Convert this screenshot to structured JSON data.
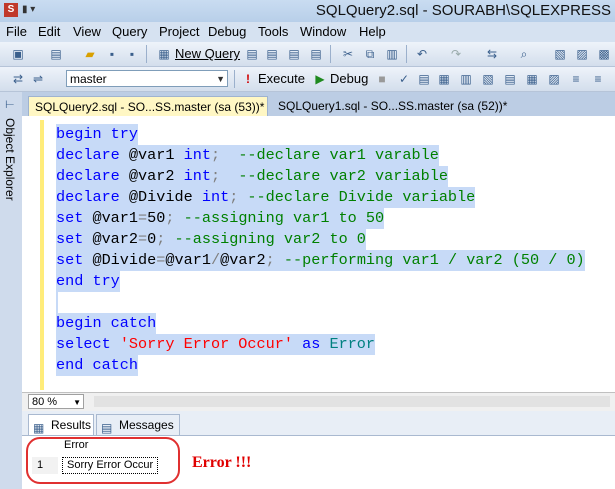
{
  "window": {
    "title": "SQLQuery2.sql - SOURABH\\SQLEXPRESS"
  },
  "menu": [
    "File",
    "Edit",
    "View",
    "Query",
    "Project",
    "Debug",
    "Tools",
    "Window",
    "Help"
  ],
  "toolbar1": {
    "new_query_label": "New Query"
  },
  "toolbar2": {
    "database_value": "master",
    "execute_label": "Execute",
    "debug_label": "Debug"
  },
  "sidebar": {
    "label": "Object Explorer"
  },
  "tabs": [
    {
      "label": "SQLQuery2.sql - SO...SS.master (sa (53))*",
      "active": true
    },
    {
      "label": "SQLQuery1.sql - SO...SS.master (sa (52))*",
      "active": false
    }
  ],
  "editor": {
    "lines": [
      "begin try",
      "declare @var1 int;  --declare var1 varable",
      "declare @var2 int;  --declare var2 variable",
      "declare @Divide int; --declare Divide variable",
      "set @var1=50; --assigning var1 to 50",
      "set @var2=0; --assigning var2 to 0",
      "set @Divide=@var1/@var2; --performing var1 / var2 (50 / 0)",
      "end try",
      "",
      "begin catch",
      "select 'Sorry Error Occur' as Error",
      "end catch"
    ]
  },
  "zoom": {
    "value": "80 %"
  },
  "results_tabs": [
    "Results",
    "Messages"
  ],
  "results_grid": {
    "columns": [
      "Error"
    ],
    "rows": [
      {
        "num": "1",
        "cells": [
          "Sorry Error Occur"
        ]
      }
    ]
  },
  "annotation": {
    "text": "Error !!!",
    "color": "#e00000"
  }
}
